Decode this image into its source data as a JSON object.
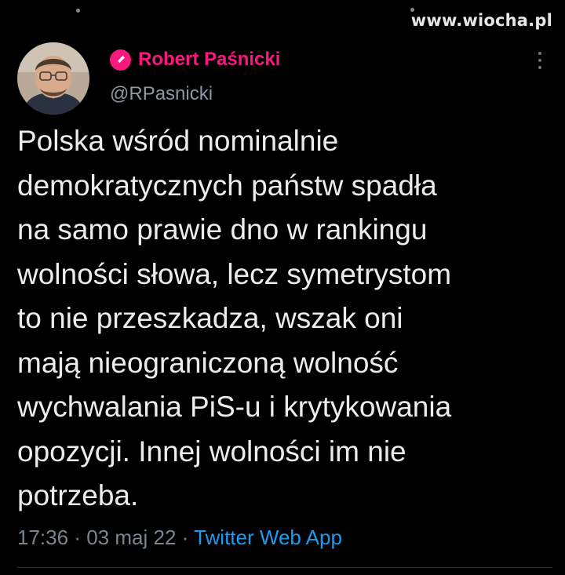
{
  "watermark": "www.wiocha.pl",
  "author": {
    "display_name": "Robert Paśnicki",
    "handle": "@RPasnicki",
    "badge_icon": "pen-icon",
    "accent_color": "#f91880"
  },
  "tweet": {
    "lines": [
      "Polska wśród nominalnie",
      "demokratycznych państw spadła",
      "na samo prawie dno w rankingu",
      "wolności słowa, lecz symetrystom",
      "to nie przeszkadza, wszak oni",
      "mają nieograniczoną wolność",
      "wychwalania PiS-u i krytykowania",
      "opozycji. Innej wolności im nie",
      "potrzeba."
    ],
    "time": "17:36",
    "separator": "·",
    "date": "03 maj 22",
    "source": "Twitter Web App",
    "link_color": "#1d9bf0"
  }
}
